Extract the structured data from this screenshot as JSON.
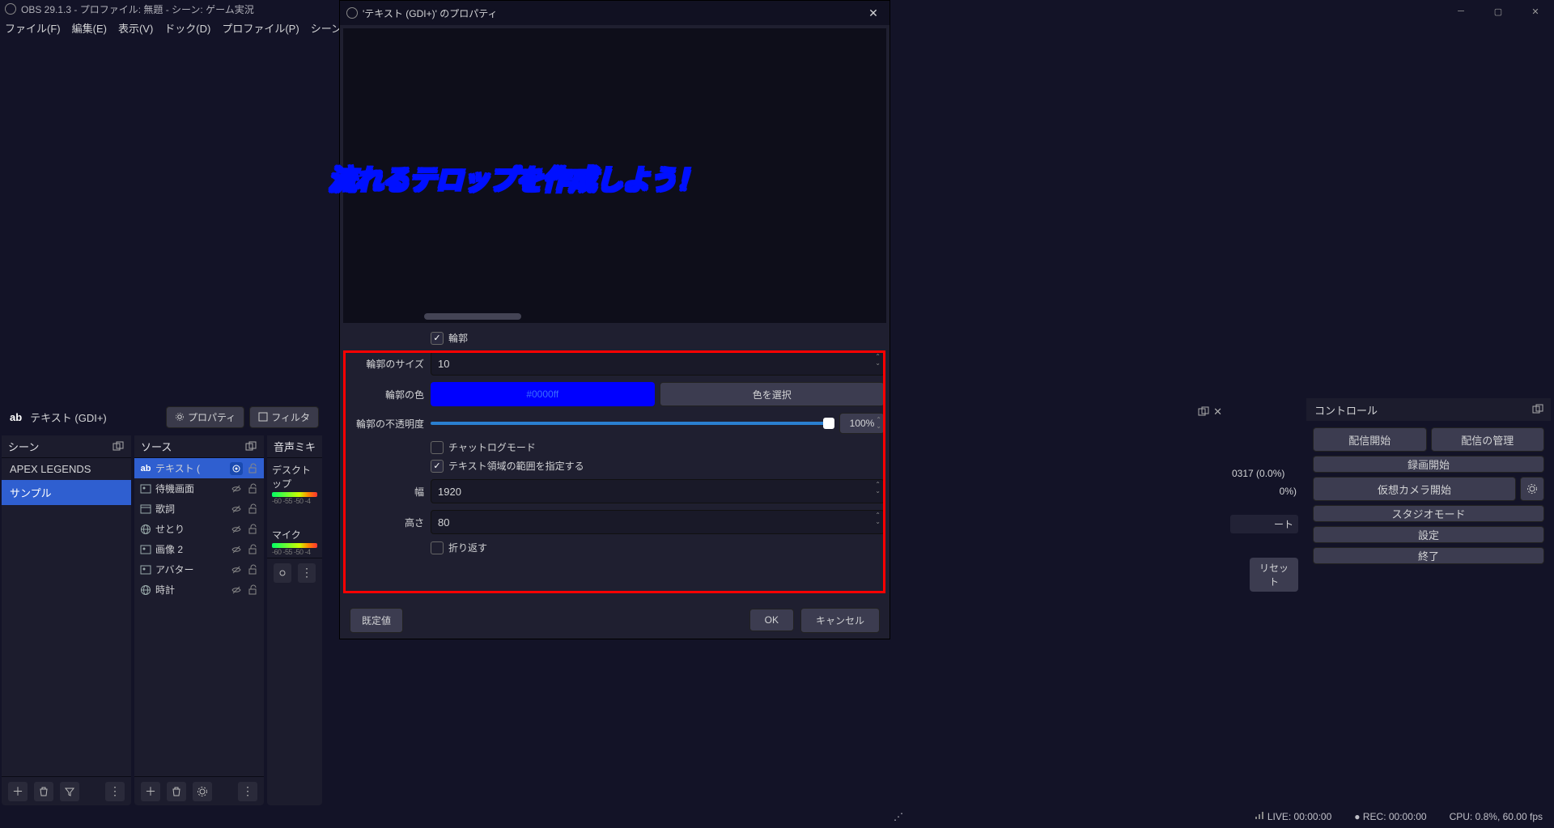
{
  "window": {
    "title": "OBS 29.1.3 - プロファイル: 無題 - シーン: ゲーム実況"
  },
  "menu": [
    "ファイル(F)",
    "編集(E)",
    "表示(V)",
    "ドック(D)",
    "プロファイル(P)",
    "シーンコレク"
  ],
  "source_label_prefix": "ab",
  "selected_source": "テキスト (GDI+)",
  "btn_properties": "プロパティ",
  "btn_filters": "フィルタ",
  "panel_scenes": "シーン",
  "panel_sources": "ソース",
  "panel_mixer": "音声ミキ",
  "scenes": [
    "APEX LEGENDS",
    "サンプル"
  ],
  "scene_selected_index": 1,
  "sources": [
    {
      "icon": "ab",
      "name": "テキスト (",
      "sel": true,
      "locked": false
    },
    {
      "icon": "img",
      "name": "待機画面",
      "sel": false
    },
    {
      "icon": "win",
      "name": "歌詞",
      "sel": false
    },
    {
      "icon": "globe",
      "name": "せとり",
      "sel": false
    },
    {
      "icon": "img",
      "name": "画像 2",
      "sel": false
    },
    {
      "icon": "img",
      "name": "アバター",
      "sel": false
    },
    {
      "icon": "globe",
      "name": "時計",
      "sel": false
    }
  ],
  "mixer": {
    "items": [
      {
        "name": "デスクトップ",
        "ticks": "-60 -55 -50 -4"
      },
      {
        "name": "マイク",
        "ticks": "-60 -55 -50 -4"
      }
    ]
  },
  "trans_right": {
    "value": "0317 (0.0%)",
    "sub": "0%)",
    "dash": "ート",
    "reset": "リセット"
  },
  "controls": {
    "title": "コントロール",
    "start_stream": "配信開始",
    "manage_stream": "配信の管理",
    "start_rec": "録画開始",
    "virt_cam": "仮想カメラ開始",
    "studio": "スタジオモード",
    "settings": "設定",
    "exit": "終了"
  },
  "status": {
    "live": "LIVE: 00:00:00",
    "rec": "REC: 00:00:00",
    "cpu": "CPU: 0.8%, 60.00 fps"
  },
  "dialog": {
    "title": "'テキスト (GDI+)' のプロパティ",
    "preview_text": "流れるテロップを作成しよう！",
    "outline_chk": "輪郭",
    "outline_size_lbl": "輪郭のサイズ",
    "outline_size": "10",
    "outline_color_lbl": "輪郭の色",
    "outline_color_hex": "#0000ff",
    "pick_color": "色を選択",
    "outline_opacity_lbl": "輪郭の不透明度",
    "outline_opacity": "100%",
    "chatlog": "チャットログモード",
    "extents": "テキスト領域の範囲を指定する",
    "width_lbl": "幅",
    "width": "1920",
    "height_lbl": "高さ",
    "height": "80",
    "wrap": "折り返す",
    "defaults": "既定値",
    "ok": "OK",
    "cancel": "キャンセル"
  }
}
